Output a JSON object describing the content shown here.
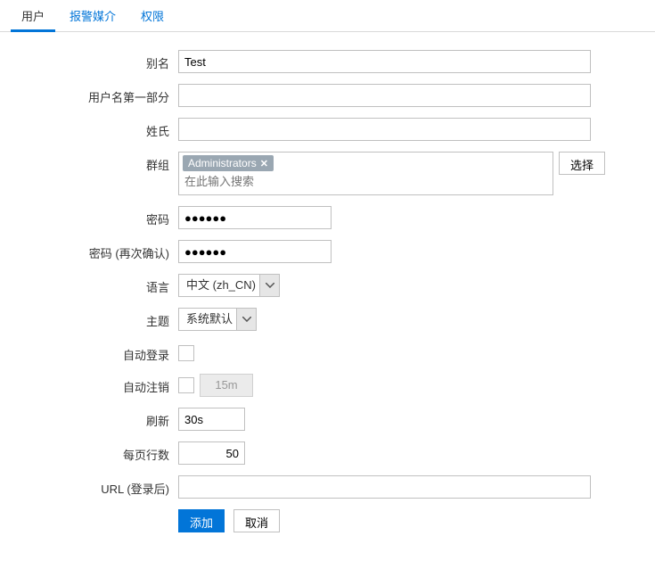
{
  "tabs": {
    "user": "用户",
    "media": "报警媒介",
    "permissions": "权限"
  },
  "labels": {
    "alias": "别名",
    "first_name": "用户名第一部分",
    "last_name": "姓氏",
    "groups": "群组",
    "password": "密码",
    "password2": "密码 (再次确认)",
    "language": "语言",
    "theme": "主题",
    "auto_login": "自动登录",
    "auto_logout": "自动注销",
    "refresh": "刷新",
    "rows": "每页行数",
    "url": "URL (登录后)"
  },
  "values": {
    "alias": "Test",
    "first_name": "",
    "last_name": "",
    "password": "●●●●●●",
    "password2": "●●●●●●",
    "language": "中文 (zh_CN)",
    "theme": "系统默认",
    "auto_logout_value": "15m",
    "refresh": "30s",
    "rows": "50",
    "url": ""
  },
  "groups": {
    "tag": "Administrators",
    "placeholder": "在此输入搜索",
    "select_btn": "选择"
  },
  "buttons": {
    "add": "添加",
    "cancel": "取消"
  }
}
